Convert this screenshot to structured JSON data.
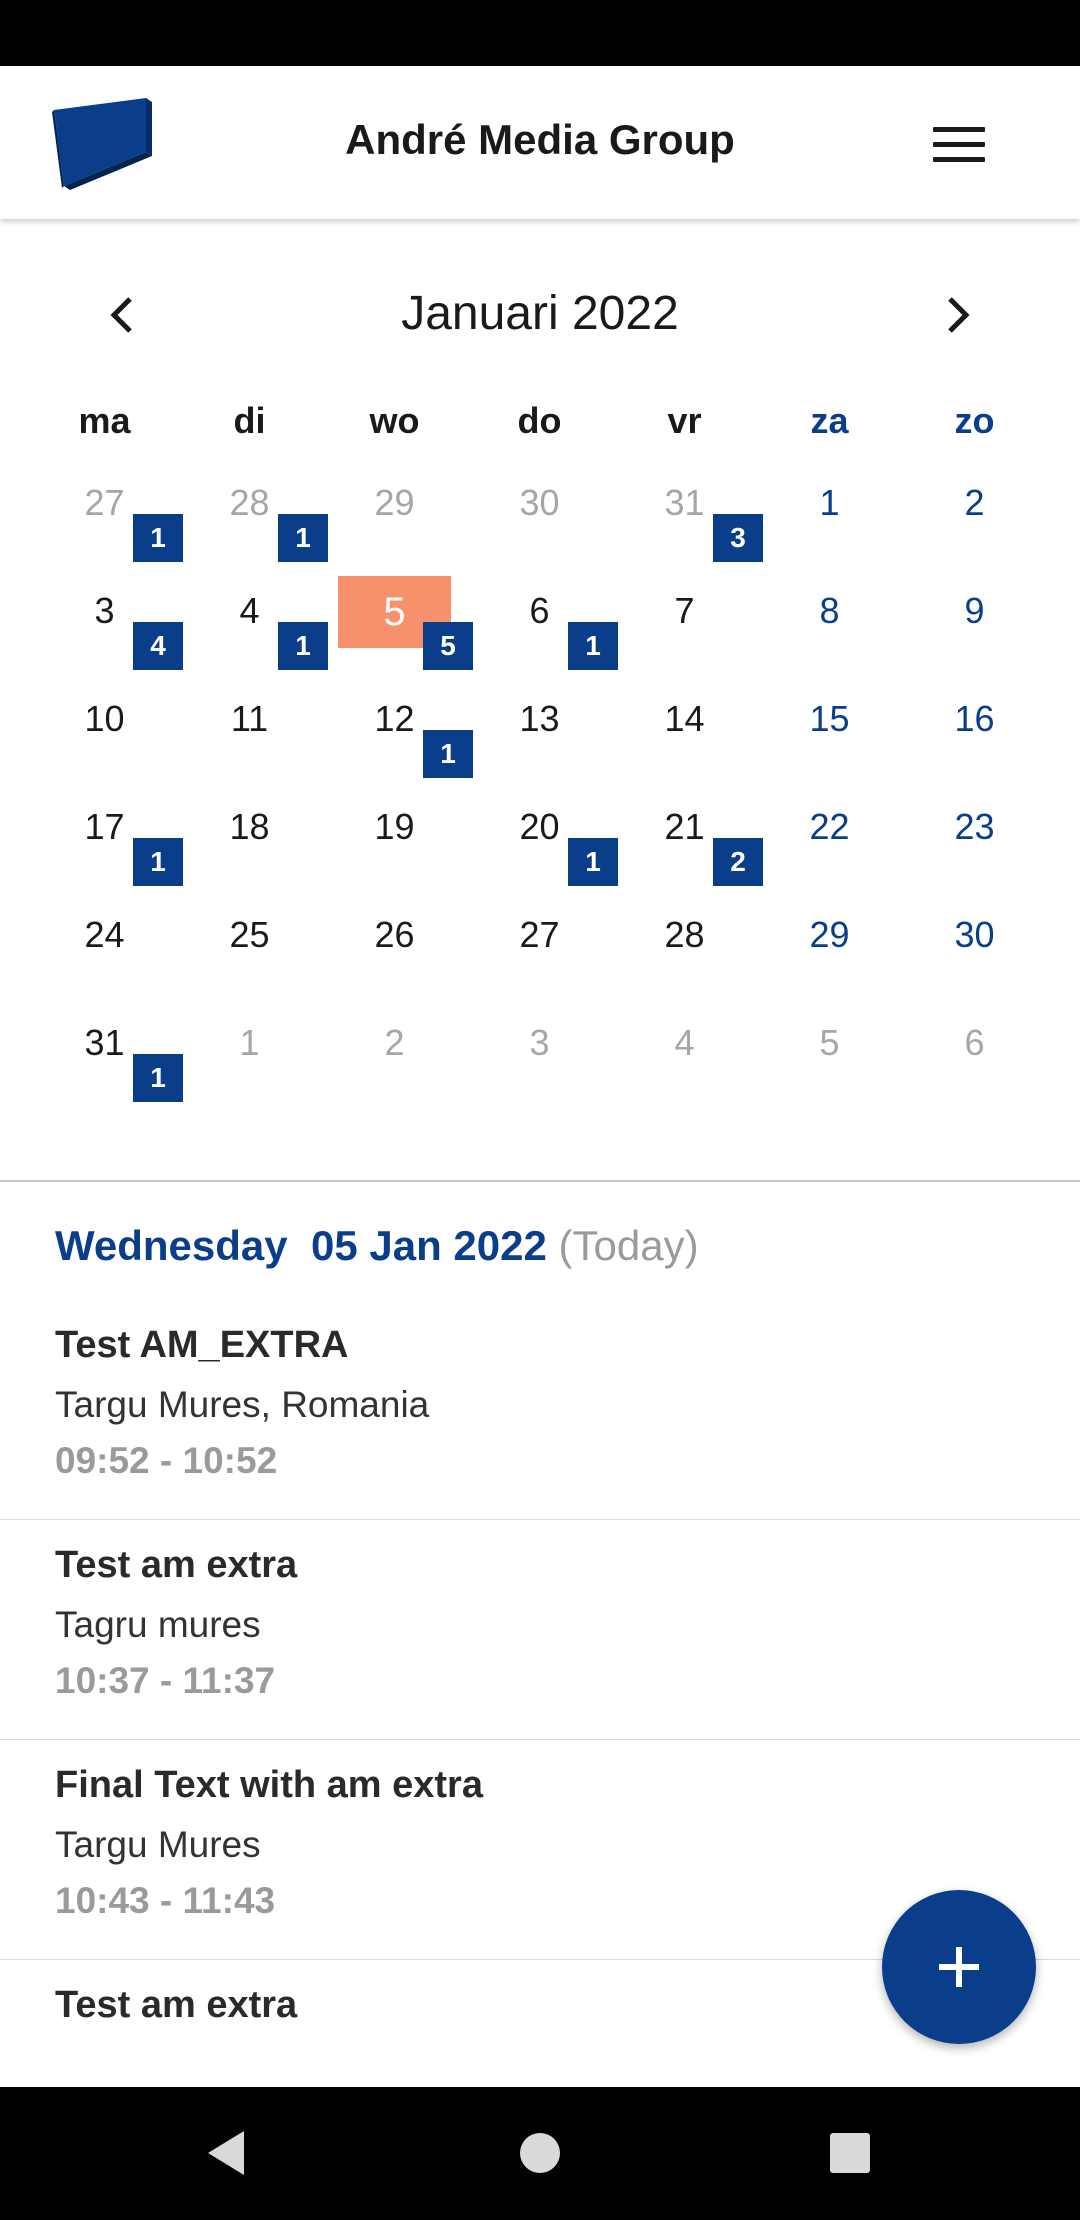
{
  "app": {
    "title": "André Media Group"
  },
  "calendar": {
    "month_title": "Januari 2022",
    "weekdays": [
      "ma",
      "di",
      "wo",
      "do",
      "vr",
      "za",
      "zo"
    ],
    "weeks": [
      [
        {
          "day": "27",
          "other": true,
          "badge": "1"
        },
        {
          "day": "28",
          "other": true,
          "badge": "1"
        },
        {
          "day": "29",
          "other": true
        },
        {
          "day": "30",
          "other": true
        },
        {
          "day": "31",
          "other": true,
          "badge": "3"
        },
        {
          "day": "1"
        },
        {
          "day": "2"
        }
      ],
      [
        {
          "day": "3",
          "badge": "4"
        },
        {
          "day": "4",
          "badge": "1"
        },
        {
          "day": "5",
          "today": true,
          "badge": "5"
        },
        {
          "day": "6",
          "badge": "1"
        },
        {
          "day": "7"
        },
        {
          "day": "8"
        },
        {
          "day": "9"
        }
      ],
      [
        {
          "day": "10"
        },
        {
          "day": "11"
        },
        {
          "day": "12",
          "badge": "1"
        },
        {
          "day": "13"
        },
        {
          "day": "14"
        },
        {
          "day": "15"
        },
        {
          "day": "16"
        }
      ],
      [
        {
          "day": "17",
          "badge": "1"
        },
        {
          "day": "18"
        },
        {
          "day": "19"
        },
        {
          "day": "20",
          "badge": "1"
        },
        {
          "day": "21",
          "badge": "2"
        },
        {
          "day": "22"
        },
        {
          "day": "23"
        }
      ],
      [
        {
          "day": "24"
        },
        {
          "day": "25"
        },
        {
          "day": "26"
        },
        {
          "day": "27"
        },
        {
          "day": "28"
        },
        {
          "day": "29"
        },
        {
          "day": "30"
        }
      ],
      [
        {
          "day": "31",
          "badge": "1"
        },
        {
          "day": "1",
          "other": true
        },
        {
          "day": "2",
          "other": true
        },
        {
          "day": "3",
          "other": true
        },
        {
          "day": "4",
          "other": true
        },
        {
          "day": "5",
          "other": true
        },
        {
          "day": "6",
          "other": true
        }
      ]
    ]
  },
  "selected_day": {
    "weekday": "Wednesday",
    "date": "05 Jan 2022",
    "today_label": "(Today)"
  },
  "events": [
    {
      "title": "Test AM_EXTRA",
      "location": "Targu Mures, Romania",
      "time": "09:52 - 10:52"
    },
    {
      "title": "Test am extra",
      "location": "Tagru mures",
      "time": "10:37 - 11:37"
    },
    {
      "title": "Final Text with am extra",
      "location": "Targu Mures",
      "time": "10:43 - 11:43"
    },
    {
      "title": "Test am extra",
      "location": "",
      "time": ""
    }
  ],
  "icons": {
    "logo": "logo-icon",
    "menu": "hamburger-menu-icon",
    "prev": "chevron-left-icon",
    "next": "chevron-right-icon",
    "fab": "plus-icon",
    "back": "back-triangle-icon",
    "home": "home-circle-icon",
    "recents": "recents-square-icon"
  },
  "colors": {
    "brand_blue": "#0a3e8a",
    "today_highlight": "#f7916c",
    "muted_text": "#9a9a9a"
  }
}
